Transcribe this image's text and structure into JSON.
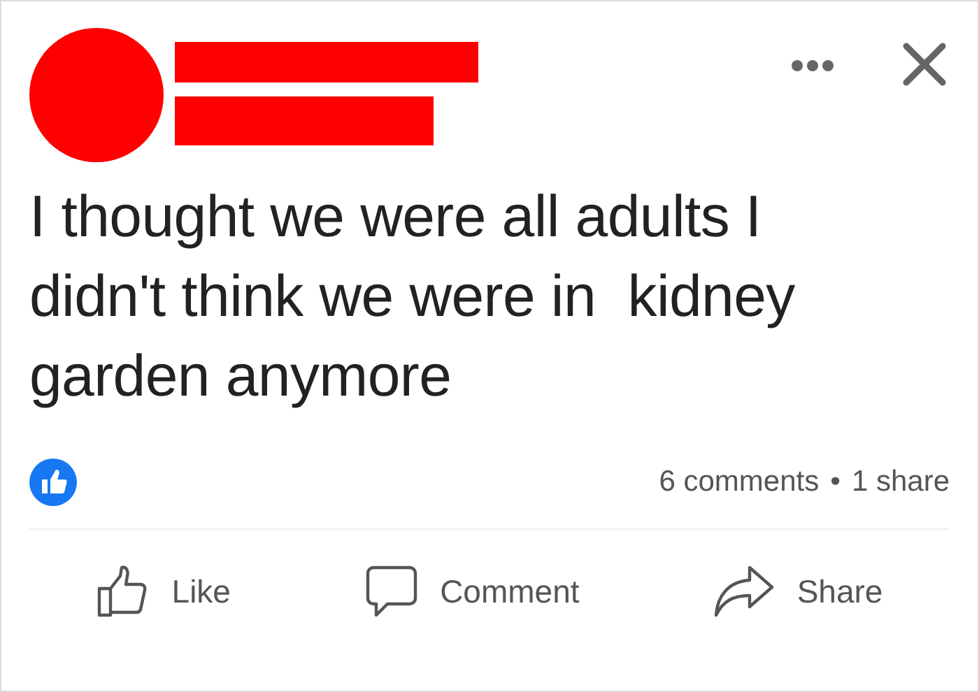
{
  "post": {
    "text_lines": [
      "I thought we were all adults I",
      "didn't think we were in  kidney",
      "garden anymore"
    ],
    "comments": "6 comments",
    "separator": "•",
    "shares": "1 share"
  },
  "actions": [
    {
      "kind": "like",
      "label": "Like"
    },
    {
      "kind": "comment",
      "label": "Comment"
    },
    {
      "kind": "share",
      "label": "Share"
    }
  ]
}
